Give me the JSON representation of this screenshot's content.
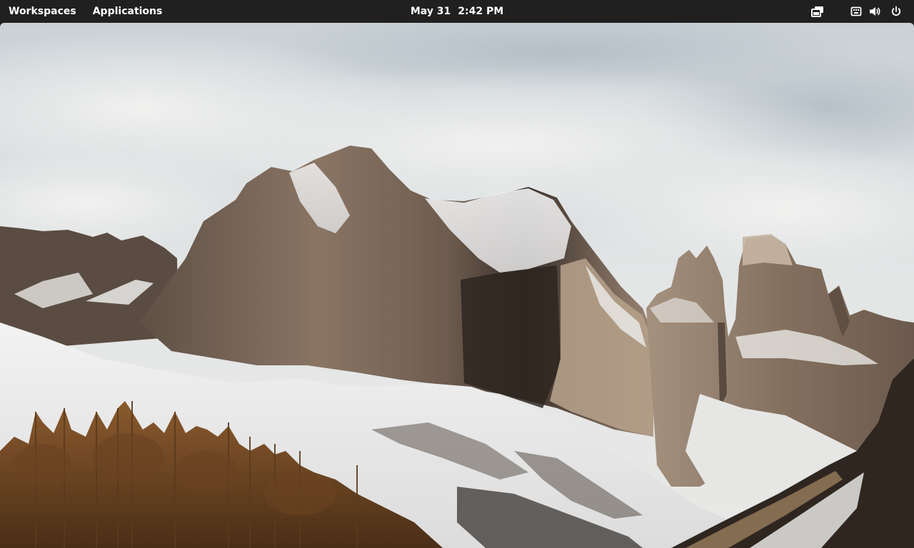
{
  "panel": {
    "workspaces_label": "Workspaces",
    "applications_label": "Applications",
    "date": "May 31",
    "time": "2:42 PM",
    "indicators": [
      "multitasking-icon",
      "keyboard-icon",
      "volume-icon",
      "power-icon"
    ]
  },
  "wallpaper": {
    "description_icon": "mountain-landscape"
  },
  "colors": {
    "panel_bg": "#202020",
    "panel_text": "#ffffff"
  }
}
